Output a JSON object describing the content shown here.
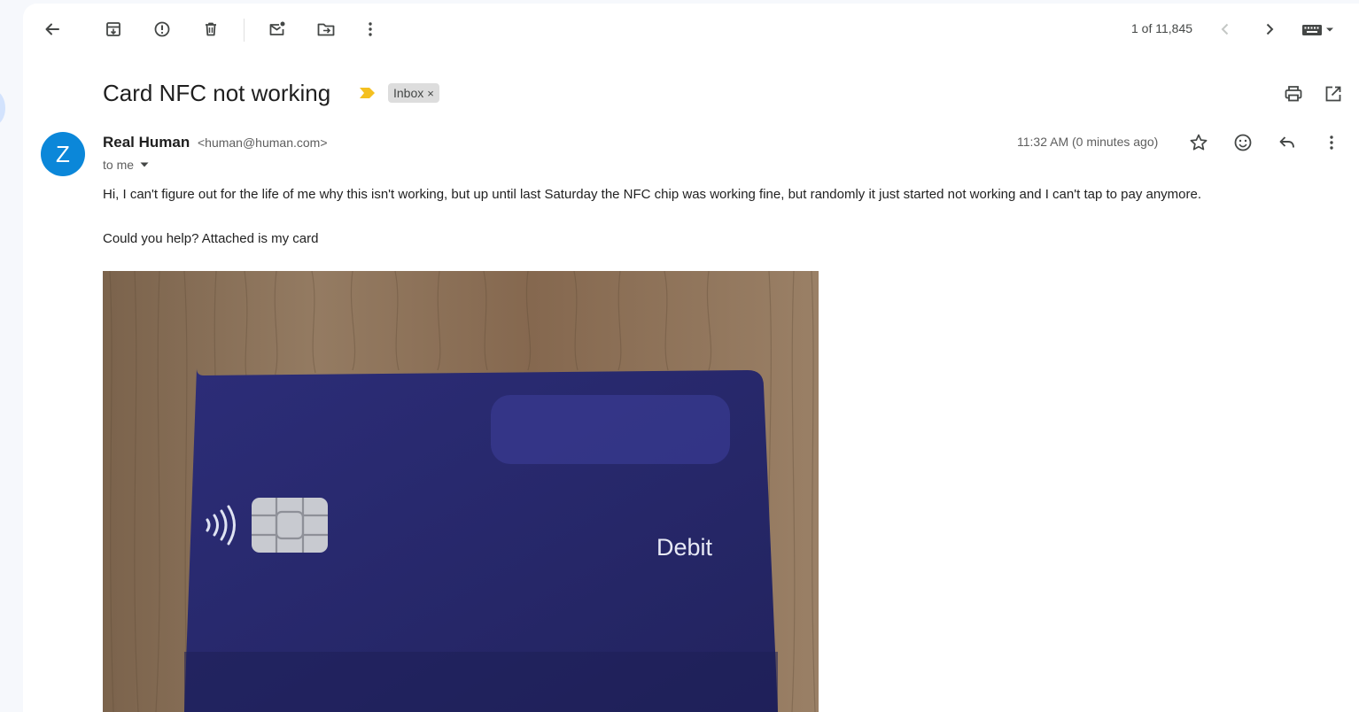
{
  "toolbar": {
    "back": "arrow-left-icon",
    "archive": "archive-icon",
    "report_spam": "report-spam-icon",
    "delete": "trash-icon",
    "mark_unread": "mark-unread-icon",
    "move_to": "move-to-folder-icon",
    "more": "more-vertical-icon",
    "pager": "1 of 11,845",
    "keyboard": "keyboard-icon"
  },
  "email": {
    "subject": "Card NFC not working",
    "label": "Inbox",
    "label_remove": "×",
    "sender_initial": "Z",
    "sender_name": "Real Human",
    "sender_email": "<human@human.com>",
    "recipient": "to me",
    "timestamp": "11:32 AM (0 minutes ago)",
    "body": [
      "Hi, I can't figure out for the life of me why this isn't working, but up until last Saturday the NFC chip was working fine, but randomly it just started not working and I can't tap to pay anymore.",
      "Could you help? Attached is my card"
    ]
  },
  "attachment": {
    "card_text": "Debit",
    "card_color": "#2a2a6e",
    "background_color": "#8d745c"
  },
  "colors": {
    "avatar": "#0b87d9",
    "importance": "#f4c020",
    "label_chip": "#dddddd"
  }
}
